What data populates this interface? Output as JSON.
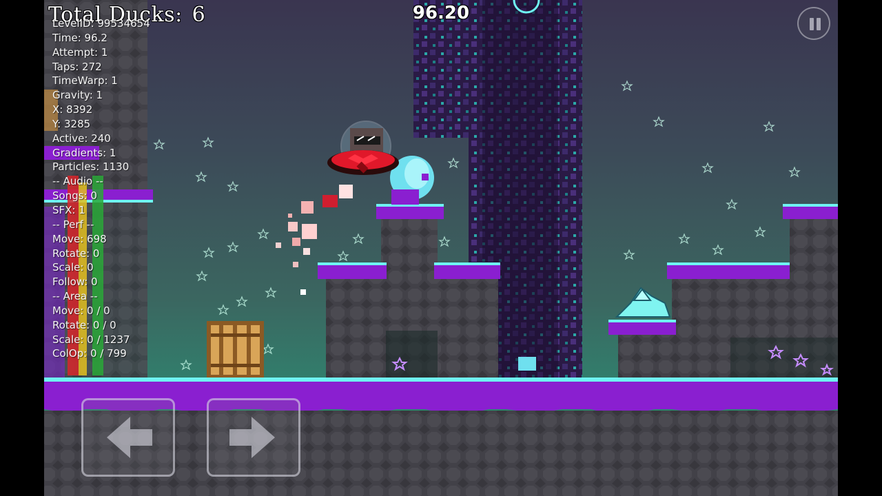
{
  "hud": {
    "total_ducks_label": "Total Ducks:",
    "total_ducks_value": "6",
    "timer": "96.20"
  },
  "debug": {
    "lines": [
      "LevelID: 99534654",
      "Time: 96.2",
      "Attempt: 1",
      "Taps: 272",
      "TimeWarp: 1",
      "Gravity: 1",
      "X: 8392",
      "Y: 3285",
      "Active: 240",
      "Gradients: 1",
      "Particles: 1130",
      "-- Audio --",
      "Songs: 0",
      "SFX: 1",
      "-- Perf --",
      "Move: 698",
      "Rotate: 0",
      "Scale: 0",
      "Follow: 0",
      "-- Area --",
      "Move: 0 / 0",
      "Rotate: 0 / 0",
      "Scale: 0 / 1237",
      "ColOp: 0 / 799"
    ]
  },
  "controls": {
    "pause_icon": "pause-icon",
    "left_icon": "arrow-left-icon",
    "right_icon": "arrow-right-icon"
  },
  "colors": {
    "purple_slime": "#8a1fd0",
    "cyan_edge": "#6ff4f2",
    "rock": "#3b3a40",
    "player_red": "#e0182a"
  }
}
